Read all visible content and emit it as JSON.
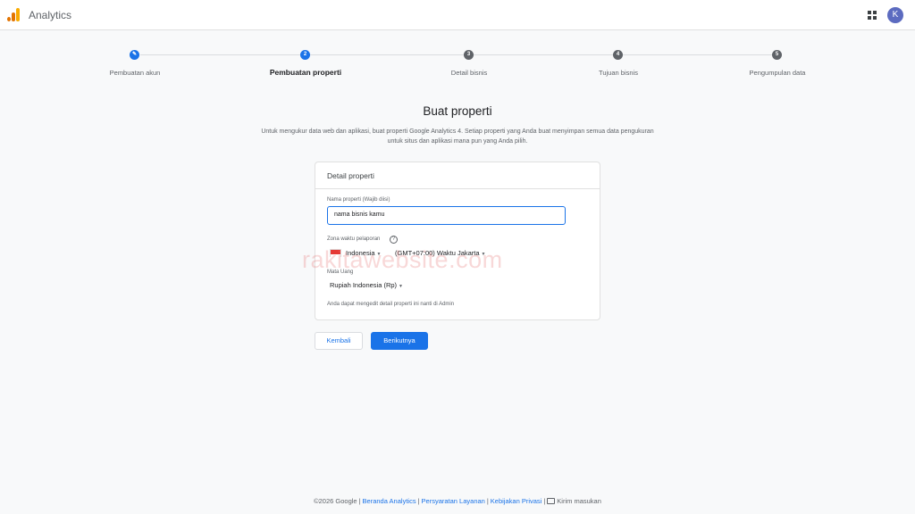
{
  "header": {
    "app_title": "Analytics",
    "logo_icon": "analytics-logo-icon",
    "apps_icon": "apps-grid-icon",
    "avatar_initial": "K"
  },
  "stepper": {
    "steps": [
      {
        "number": "✎",
        "label": "Pembuatan akun",
        "state": "completed"
      },
      {
        "number": "2",
        "label": "Pembuatan properti",
        "state": "current"
      },
      {
        "number": "3",
        "label": "Detail bisnis",
        "state": "upcoming"
      },
      {
        "number": "4",
        "label": "Tujuan bisnis",
        "state": "upcoming"
      },
      {
        "number": "5",
        "label": "Pengumpulan data",
        "state": "upcoming"
      }
    ]
  },
  "main": {
    "title": "Buat properti",
    "description": "Untuk mengukur data web dan aplikasi, buat properti Google Analytics 4. Setiap properti yang Anda buat menyimpan semua data pengukuran untuk situs dan aplikasi mana pun yang Anda pilih."
  },
  "card": {
    "title": "Detail properti",
    "property_name_label": "Nama properti (Wajib diisi)",
    "property_name_value": "nama bisnis kamu",
    "timezone_label": "Zona waktu pelaporan",
    "country_value": "Indonesia",
    "timezone_value": "(GMT+07:00) Waktu Jakarta",
    "currency_label": "Mata Uang",
    "currency_value": "Rupiah Indonesia (Rp)",
    "note": "Anda dapat mengedit detail properti ini nanti di Admin"
  },
  "actions": {
    "back_label": "Kembali",
    "next_label": "Berikutnya"
  },
  "watermark": "rakitawebsite.com",
  "footer": {
    "copyright": "©2026 Google",
    "links": [
      "Beranda Analytics",
      "Persyaratan Layanan",
      "Kebijakan Privasi"
    ],
    "feedback_label": "Kirim masukan"
  },
  "colors": {
    "accent": "#1a73e8",
    "background": "#f8f9fa",
    "step_inactive": "#5f6368"
  }
}
